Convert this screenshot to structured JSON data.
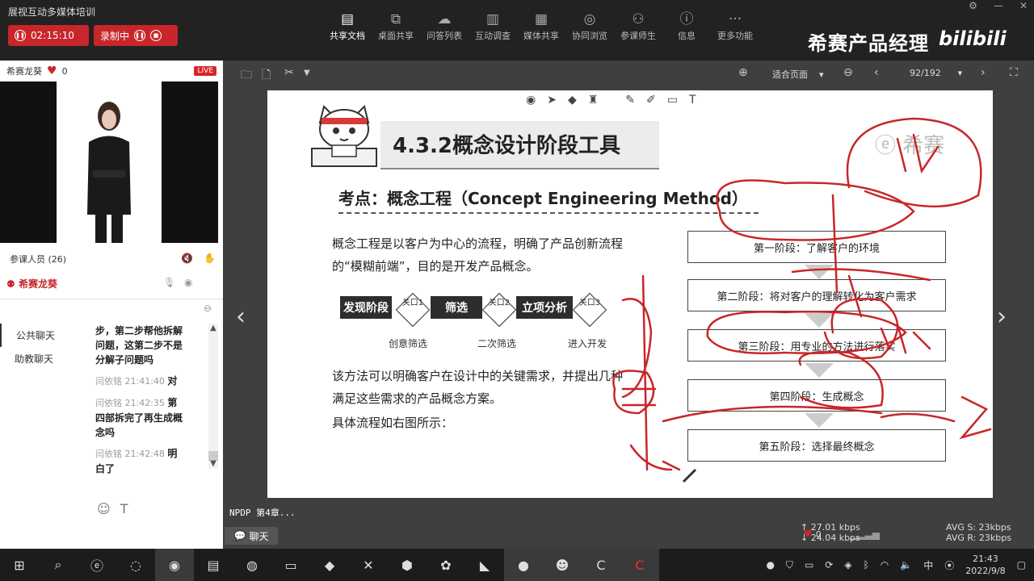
{
  "app": {
    "title": "展视互动多媒体培训"
  },
  "recording": {
    "timer": "02:15:10",
    "record_label": "录制中"
  },
  "toolbar": {
    "items": [
      {
        "label": "共享文档",
        "icon": "doc-icon"
      },
      {
        "label": "桌面共享",
        "icon": "screen-share-icon"
      },
      {
        "label": "问答列表",
        "icon": "qa-icon"
      },
      {
        "label": "互动调查",
        "icon": "poll-icon"
      },
      {
        "label": "媒体共享",
        "icon": "media-icon"
      },
      {
        "label": "协同浏览",
        "icon": "browse-icon"
      },
      {
        "label": "参课师生",
        "icon": "people-icon"
      },
      {
        "label": "信息",
        "icon": "info-icon"
      },
      {
        "label": "更多功能",
        "icon": "more-icon"
      }
    ]
  },
  "brand": {
    "text": "希赛产品经理",
    "bili": "bilibili"
  },
  "presenter": {
    "name": "希赛龙葵",
    "likes": "0",
    "live": "LIVE"
  },
  "attendees": {
    "label": "参课人员 (26)"
  },
  "host": {
    "name": "希赛龙葵"
  },
  "chat": {
    "tabs": [
      "公共聊天",
      "助教聊天"
    ],
    "messages": [
      {
        "meta": "",
        "lines": [
          "步，第二步帮他拆解",
          "问题，这第二步不是",
          "分解子问题吗"
        ]
      },
      {
        "meta": "闫依铭 21:41:40",
        "lines": [
          "对"
        ]
      },
      {
        "meta": "闫依铭 21:42:35",
        "lines": [
          "第",
          "四部拆完了再生成概",
          "念吗"
        ]
      },
      {
        "meta": "闫依铭 21:42:48",
        "lines": [
          "明",
          "白了"
        ]
      }
    ]
  },
  "doc": {
    "zoom": "适合页面",
    "page": "92/192",
    "course_label": "NPDP 第4章..."
  },
  "slide": {
    "title": "4.3.2概念设计阶段工具",
    "logo": "希赛",
    "subtitle": "考点：概念工程（Concept Engineering Method）",
    "para1": "概念工程是以客户为中心的流程，明确了产品创新流程的“模糊前端”，目的是开发产品概念。",
    "para2": "该方法可以明确客户在设计中的关键需求，并提出几种满足这些需求的产品概念方案。",
    "para3": "具体流程如右图所示：",
    "phases": [
      "发现阶段",
      "筛选",
      "立项分析"
    ],
    "gates": [
      "关口1",
      "关口2",
      "关口3"
    ],
    "under": [
      "创意筛选",
      "二次筛选",
      "进入开发"
    ],
    "stages": [
      "第一阶段：了解客户的环境",
      "第二阶段：将对客户的理解转化为客户需求",
      "第三阶段：用专业的方法进行落实",
      "第四阶段：生成概念",
      "第五阶段：选择最终概念"
    ]
  },
  "stats": {
    "up": "27.01 kbps",
    "down": "24.04 kbps",
    "avg_s": "AVG S: 23kbps",
    "avg_r": "AVG R: 23kbps",
    "likes": "0"
  },
  "chat_button": "聊天",
  "clock": {
    "time": "21:43",
    "date": "2022/9/8"
  },
  "tray": {
    "ime": "中"
  }
}
